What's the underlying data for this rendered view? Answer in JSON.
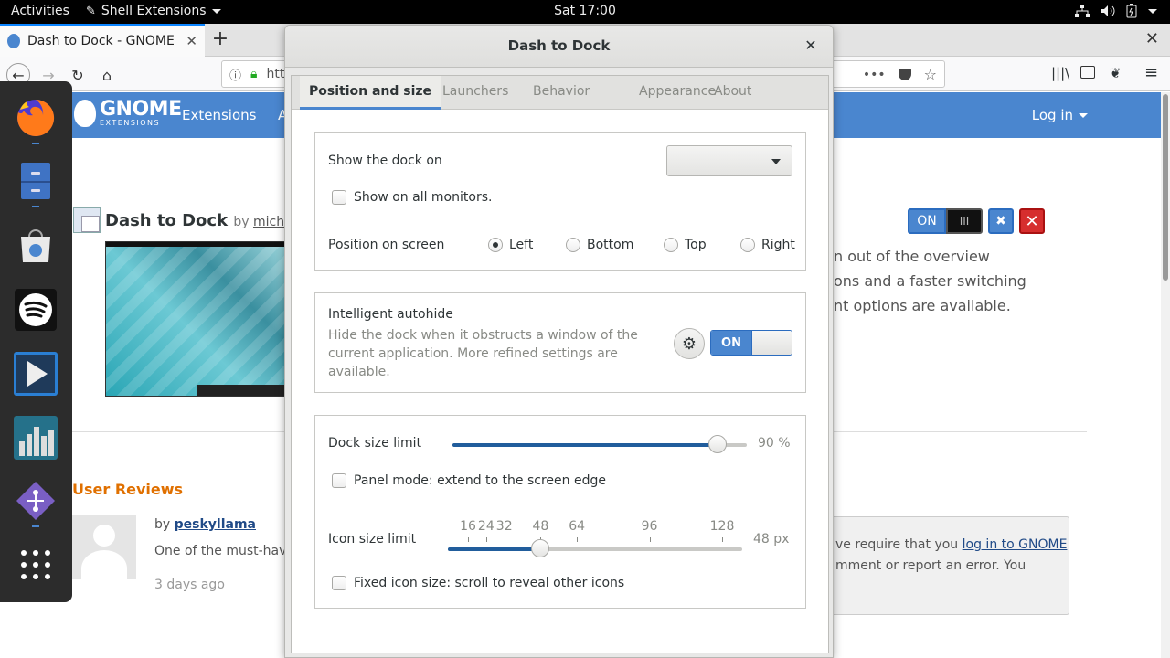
{
  "topbar": {
    "activities": "Activities",
    "app_menu": "Shell Extensions",
    "clock": "Sat 17:00"
  },
  "browser": {
    "tab_title": "Dash to Dock - GNOME S",
    "url_partial": "htt"
  },
  "page": {
    "nav_links": [
      "Extensions",
      "A"
    ],
    "logo_word": "GNOME",
    "logo_sub": "EXTENSIONS",
    "login": "Log in",
    "ext_name": "Dash to Dock",
    "ext_by": "by",
    "ext_author": "michele_g",
    "desc_lines": [
      "n out of the overview",
      "ons and a faster switching",
      "nt options are available."
    ],
    "toggle_on": "ON",
    "toggle_off": "III",
    "reviews_title": "User Reviews",
    "review": {
      "by": "by",
      "author": "peskyllama",
      "text": "One of the must-have e",
      "date": "3 days ago"
    },
    "login_box": {
      "line1_prefix": "ve require that you",
      "line1_link": "log in to GNOME",
      "line2": "mment or report an error. You"
    }
  },
  "dock": {
    "apps": [
      "firefox",
      "files",
      "software",
      "spotify",
      "videos",
      "sysmon",
      "git-app",
      "show-apps"
    ]
  },
  "dialog": {
    "title": "Dash to Dock",
    "tabs": [
      {
        "label": "Position and size",
        "active": true
      },
      {
        "label": "Launchers",
        "active": false
      },
      {
        "label": "Behavior",
        "active": false
      },
      {
        "label": "Appearance",
        "active": false
      },
      {
        "label": "About",
        "active": false
      }
    ],
    "position": {
      "show_dock_on_label": "Show the dock on",
      "show_dock_on_value": "",
      "all_monitors_label": "Show on all monitors.",
      "all_monitors_checked": false,
      "position_label": "Position on screen",
      "options": [
        "Left",
        "Bottom",
        "Top",
        "Right"
      ],
      "selected": "Left"
    },
    "autohide": {
      "title": "Intelligent autohide",
      "description": "Hide the dock when it obstructs a window of the current application. More refined settings are available.",
      "switch_label": "ON",
      "enabled": true
    },
    "size": {
      "dock_size_label": "Dock size limit",
      "dock_size_value": 90,
      "dock_size_display": "90 %",
      "panel_mode_label": "Panel mode: extend to the screen edge",
      "panel_mode_checked": false,
      "icon_size_label": "Icon size limit",
      "icon_size_value": 48,
      "icon_size_display": "48 px",
      "icon_ticks": [
        "16",
        "24",
        "32",
        "48",
        "64",
        "96",
        "128"
      ],
      "fixed_icon_label": "Fixed icon size: scroll to reveal other icons",
      "fixed_icon_checked": false
    }
  }
}
